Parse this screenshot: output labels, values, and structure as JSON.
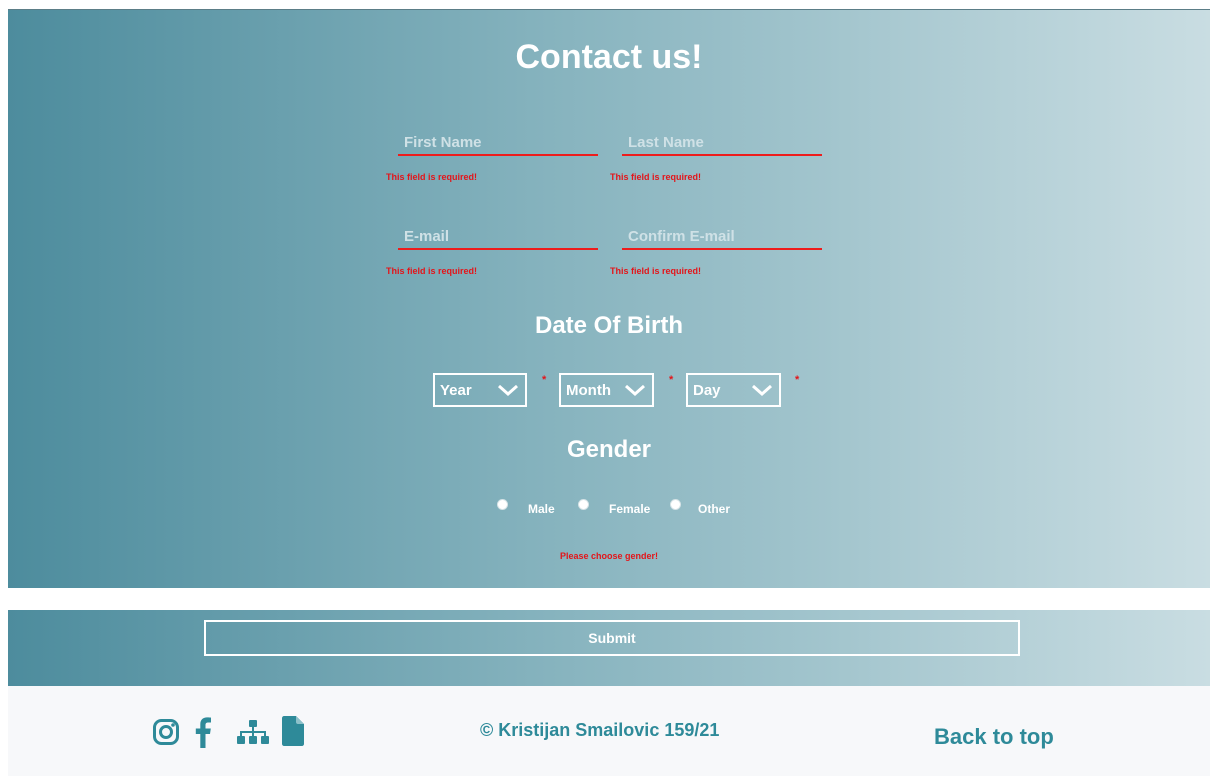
{
  "contact": {
    "title": "Contact us!",
    "first_name_placeholder": "First Name",
    "last_name_placeholder": "Last Name",
    "email_placeholder": "E-mail",
    "confirm_email_placeholder": "Confirm E-mail",
    "required_error": "This field is required!",
    "dob_title": "Date Of Birth",
    "year_label": "Year",
    "month_label": "Month",
    "day_label": "Day",
    "required_mark": "*",
    "gender_title": "Gender",
    "gender_options": [
      "Male",
      "Female",
      "Other"
    ],
    "gender_error": "Please choose gender!"
  },
  "submit": {
    "label": "Submit"
  },
  "footer": {
    "copyright": "© Kristijan Smailovic 159/21",
    "back_to_top": "Back to top",
    "icons": [
      "instagram-icon",
      "facebook-icon",
      "sitemap-icon",
      "document-icon"
    ]
  },
  "colors": {
    "gradient_start": "#4d8c9d",
    "gradient_end": "#c9dde2",
    "error": "#e3151a",
    "footer_text": "#2e8a99",
    "footer_bg": "#f7f8fa"
  }
}
